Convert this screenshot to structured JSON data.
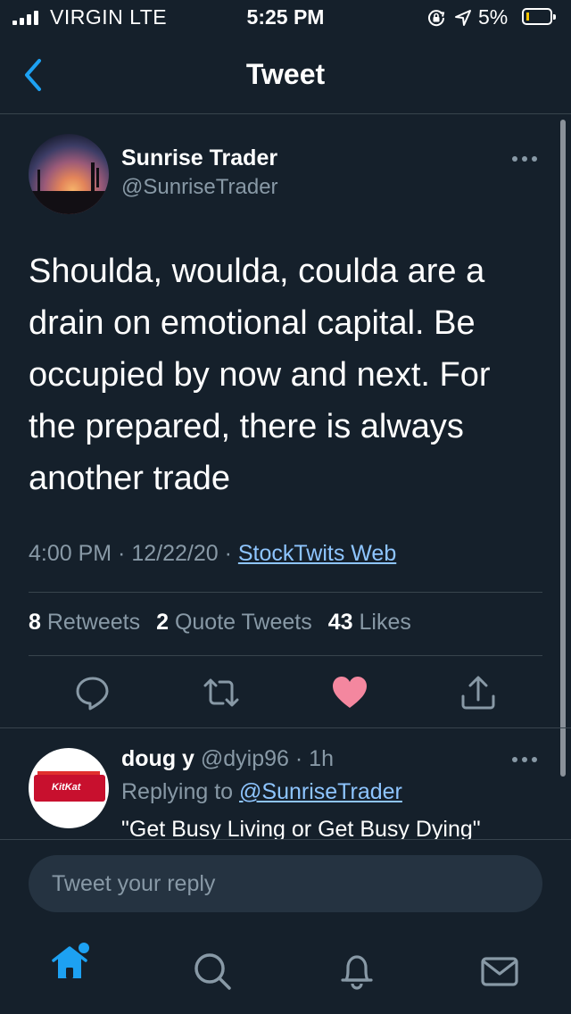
{
  "status_bar": {
    "carrier": "VIRGIN  LTE",
    "time": "5:25 PM",
    "battery_percent": "5%",
    "battery_level": 0.05,
    "icons": [
      "signal-icon",
      "rotation-lock-icon",
      "location-arrow-icon",
      "battery-icon"
    ]
  },
  "header": {
    "title": "Tweet",
    "back_icon": "chevron-left-icon"
  },
  "tweet": {
    "author_name": "Sunrise Trader",
    "author_handle": "@SunriseTrader",
    "text": "Shoulda, woulda, coulda are a drain on emotional capital.  Be occupied by now and next.  For the prepared, there is always another trade",
    "time": "4:00 PM",
    "date": "12/22/20",
    "source": "StockTwits Web",
    "separator": " · ",
    "stats": {
      "retweets_count": "8",
      "retweets_label": "Retweets",
      "quotes_count": "2",
      "quotes_label": "Quote Tweets",
      "likes_count": "43",
      "likes_label": "Likes"
    },
    "actions": [
      "reply-icon",
      "retweet-icon",
      "like-icon",
      "share-icon"
    ],
    "liked": true
  },
  "reply": {
    "author_name": "doug y",
    "author_handle": "@dyip96",
    "time_ago": "1h",
    "replying_prefix": "Replying to",
    "replying_to": "@SunriseTrader",
    "text": "\"Get Busy Living or Get Busy Dying\"",
    "avatar_text": "KitKat"
  },
  "composer": {
    "placeholder": "Tweet your reply",
    "value": ""
  },
  "tab_bar": {
    "tabs": [
      "home-icon",
      "search-icon",
      "notifications-icon",
      "messages-icon"
    ],
    "active": "home-icon"
  },
  "colors": {
    "background": "#15202b",
    "accent": "#1da1f2",
    "link": "#8ec5ff",
    "muted": "#8899a6",
    "like": "#f4879f",
    "divider": "#38444d"
  }
}
